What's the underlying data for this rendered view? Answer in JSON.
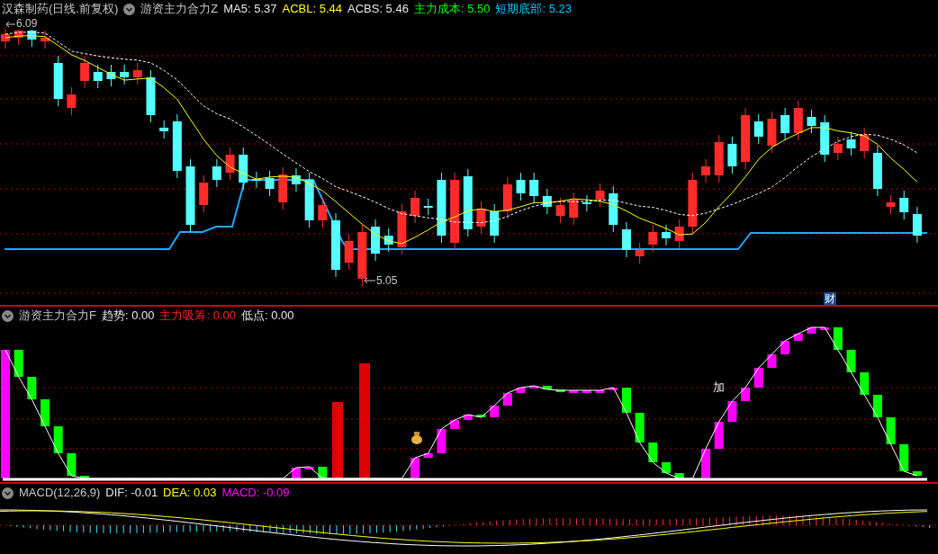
{
  "price_panel": {
    "title": "汉森制药(日线.前复权)",
    "indicator": "游资主力合力Z",
    "readouts": [
      {
        "label": "MA5:",
        "value": "5.37",
        "color": "#e8e8e8"
      },
      {
        "label": "ACBL:",
        "value": "5.44",
        "color": "#ffff00"
      },
      {
        "label": "ACBS:",
        "value": "5.46",
        "color": "#e8e8e8"
      },
      {
        "label": "主力成本:",
        "value": "5.50",
        "color": "#00ff00"
      },
      {
        "label": "短期底部:",
        "value": "5.23",
        "color": "#00c8ff"
      }
    ],
    "high_label": "6.09",
    "low_label": "5.05",
    "badge": "财"
  },
  "indicator_panel": {
    "indicator": "游资主力合力F",
    "readouts": [
      {
        "label": "趋势:",
        "value": "0.00",
        "color": "#e8e8e8"
      },
      {
        "label": "主力吸筹:",
        "value": "0.00",
        "color": "#ff2020"
      },
      {
        "label": "低点:",
        "value": "0.00",
        "color": "#e8e8e8"
      }
    ],
    "note": "加"
  },
  "macd_panel": {
    "indicator": "MACD(12,26,9)",
    "readouts": [
      {
        "label": "DIF:",
        "value": "-0.01",
        "color": "#e8e8e8"
      },
      {
        "label": "DEA:",
        "value": "0.03",
        "color": "#ffff00"
      },
      {
        "label": "MACD:",
        "value": "-0.09",
        "color": "#ff00ff"
      }
    ]
  }
}
